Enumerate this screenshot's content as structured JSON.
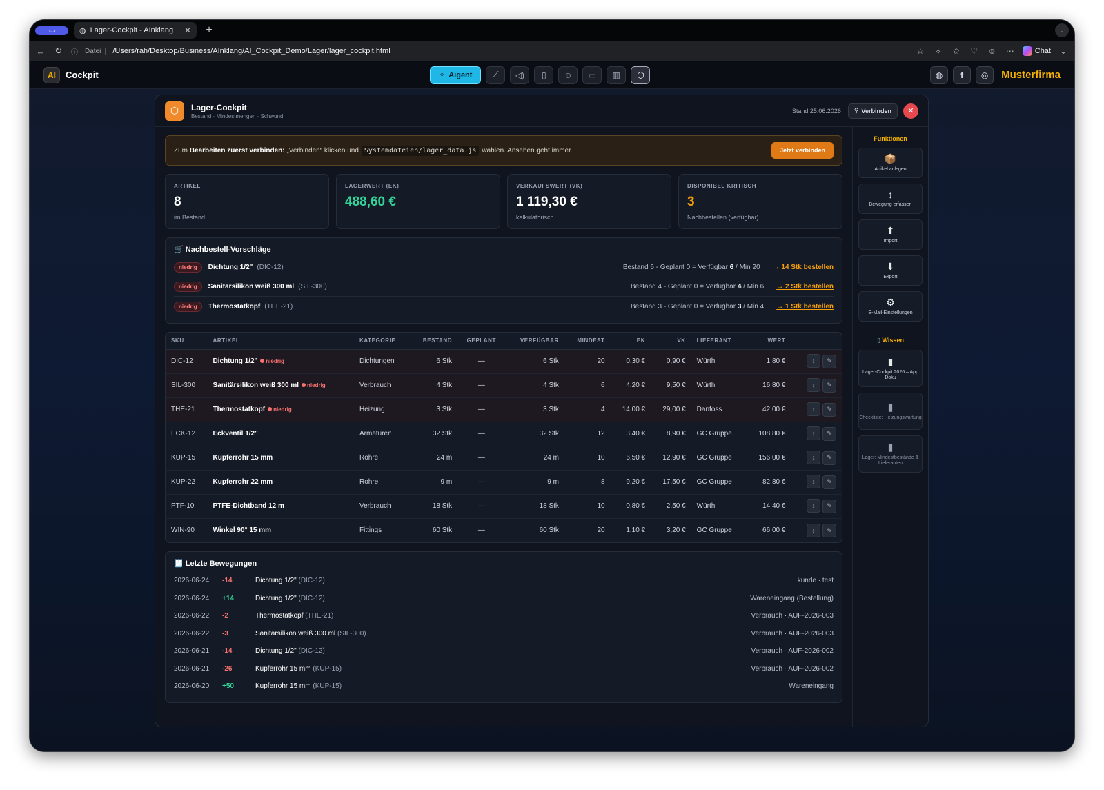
{
  "browser": {
    "tab_title": "Lager-Cockpit - AInklang",
    "url_prefix": "Datei",
    "url": "/Users/rah/Desktop/Business/AInklang/AI_Cockpit_Demo/Lager/lager_cockpit.html",
    "chat_label": "Chat"
  },
  "app": {
    "logo": "AI",
    "name": "Cockpit",
    "agent_label": "Aigent",
    "company": "Musterfirma"
  },
  "modal": {
    "title": "Lager-Cockpit",
    "subtitle": "Bestand · Mindestmengen · Schwund",
    "stand": "Stand 25.06.2026",
    "connect_label": "Verbinden"
  },
  "banner": {
    "prefix": "Zum",
    "bold": "Bearbeiten zuerst verbinden:",
    "middle": "„Verbinden“ klicken und",
    "code": "Systemdateien/lager_data.js",
    "suffix": "wählen. Ansehen geht immer.",
    "button": "Jetzt verbinden"
  },
  "kpis": [
    {
      "label": "ARTIKEL",
      "value": "8",
      "sub": "im Bestand"
    },
    {
      "label": "LAGERWERT (EK)",
      "value": "488,60 €",
      "sub": ""
    },
    {
      "label": "VERKAUFSWERT (VK)",
      "value": "1 119,30 €",
      "sub": "kalkulatorisch"
    },
    {
      "label": "DISPONIBEL KRITISCH",
      "value": "3",
      "sub": "Nachbestellen (verfügbar)"
    }
  ],
  "reorder": {
    "title": "Nachbestell-Vorschläge",
    "items": [
      {
        "badge": "niedrig",
        "name": "Dichtung 1/2\"",
        "sku": "(DIC-12)",
        "calc_pre": "Bestand 6 - Geplant 0 = Verfügbar",
        "avail": "6",
        "calc_post": "/ Min 20",
        "order": "→ 14 Stk bestellen"
      },
      {
        "badge": "niedrig",
        "name": "Sanitärsilikon weiß 300 ml",
        "sku": "(SIL-300)",
        "calc_pre": "Bestand 4 - Geplant 0 = Verfügbar",
        "avail": "4",
        "calc_post": "/ Min 6",
        "order": "→ 2 Stk bestellen"
      },
      {
        "badge": "niedrig",
        "name": "Thermostatkopf",
        "sku": "(THE-21)",
        "calc_pre": "Bestand 3 - Geplant 0 = Verfügbar",
        "avail": "3",
        "calc_post": "/ Min 4",
        "order": "→ 1 Stk bestellen"
      }
    ]
  },
  "table": {
    "headers": [
      "SKU",
      "ARTIKEL",
      "KATEGORIE",
      "BESTAND",
      "GEPLANT",
      "VERFÜGBAR",
      "MINDEST",
      "EK",
      "VK",
      "LIEFERANT",
      "WERT"
    ],
    "low_label": "niedrig",
    "rows": [
      {
        "sku": "DIC-12",
        "name": "Dichtung 1/2\"",
        "low": true,
        "cat": "Dichtungen",
        "stock": "6 Stk",
        "planned": "—",
        "avail": "6 Stk",
        "min": "20",
        "ek": "0,30 €",
        "vk": "0,90 €",
        "supplier": "Würth",
        "value": "1,80 €"
      },
      {
        "sku": "SIL-300",
        "name": "Sanitärsilikon weiß 300 ml",
        "low": true,
        "cat": "Verbrauch",
        "stock": "4 Stk",
        "planned": "—",
        "avail": "4 Stk",
        "min": "6",
        "ek": "4,20 €",
        "vk": "9,50 €",
        "supplier": "Würth",
        "value": "16,80 €"
      },
      {
        "sku": "THE-21",
        "name": "Thermostatkopf",
        "low": true,
        "cat": "Heizung",
        "stock": "3 Stk",
        "planned": "—",
        "avail": "3 Stk",
        "min": "4",
        "ek": "14,00 €",
        "vk": "29,00 €",
        "supplier": "Danfoss",
        "value": "42,00 €"
      },
      {
        "sku": "ECK-12",
        "name": "Eckventil 1/2\"",
        "low": false,
        "cat": "Armaturen",
        "stock": "32 Stk",
        "planned": "—",
        "avail": "32 Stk",
        "min": "12",
        "ek": "3,40 €",
        "vk": "8,90 €",
        "supplier": "GC Gruppe",
        "value": "108,80 €"
      },
      {
        "sku": "KUP-15",
        "name": "Kupferrohr 15 mm",
        "low": false,
        "cat": "Rohre",
        "stock": "24 m",
        "planned": "—",
        "avail": "24 m",
        "min": "10",
        "ek": "6,50 €",
        "vk": "12,90 €",
        "supplier": "GC Gruppe",
        "value": "156,00 €"
      },
      {
        "sku": "KUP-22",
        "name": "Kupferrohr 22 mm",
        "low": false,
        "cat": "Rohre",
        "stock": "9 m",
        "planned": "—",
        "avail": "9 m",
        "min": "8",
        "ek": "9,20 €",
        "vk": "17,50 €",
        "supplier": "GC Gruppe",
        "value": "82,80 €"
      },
      {
        "sku": "PTF-10",
        "name": "PTFE-Dichtband 12 m",
        "low": false,
        "cat": "Verbrauch",
        "stock": "18 Stk",
        "planned": "—",
        "avail": "18 Stk",
        "min": "10",
        "ek": "0,80 €",
        "vk": "2,50 €",
        "supplier": "Würth",
        "value": "14,40 €"
      },
      {
        "sku": "WIN-90",
        "name": "Winkel 90° 15 mm",
        "low": false,
        "cat": "Fittings",
        "stock": "60 Stk",
        "planned": "—",
        "avail": "60 Stk",
        "min": "20",
        "ek": "1,10 €",
        "vk": "3,20 €",
        "supplier": "GC Gruppe",
        "value": "66,00 €"
      }
    ]
  },
  "moves": {
    "title": "Letzte Bewegungen",
    "rows": [
      {
        "date": "2026-06-24",
        "qty": "-14",
        "name": "Dichtung 1/2\"",
        "sku": "(DIC-12)",
        "info": "kunde · test"
      },
      {
        "date": "2026-06-24",
        "qty": "+14",
        "name": "Dichtung 1/2\"",
        "sku": "(DIC-12)",
        "info": "Wareneingang (Bestellung)"
      },
      {
        "date": "2026-06-22",
        "qty": "-2",
        "name": "Thermostatkopf",
        "sku": "(THE-21)",
        "info": "Verbrauch · AUF-2026-003"
      },
      {
        "date": "2026-06-22",
        "qty": "-3",
        "name": "Sanitärsilikon weiß 300 ml",
        "sku": "(SIL-300)",
        "info": "Verbrauch · AUF-2026-003"
      },
      {
        "date": "2026-06-21",
        "qty": "-14",
        "name": "Dichtung 1/2\"",
        "sku": "(DIC-12)",
        "info": "Verbrauch · AUF-2026-002"
      },
      {
        "date": "2026-06-21",
        "qty": "-26",
        "name": "Kupferrohr 15 mm",
        "sku": "(KUP-15)",
        "info": "Verbrauch · AUF-2026-002"
      },
      {
        "date": "2026-06-20",
        "qty": "+50",
        "name": "Kupferrohr 15 mm",
        "sku": "(KUP-15)",
        "info": "Wareneingang"
      }
    ]
  },
  "sidebar": {
    "functions_title": "Funktionen",
    "functions": [
      {
        "icon": "package-icon",
        "label": "Artikel anlegen"
      },
      {
        "icon": "updown-arrow-icon",
        "label": "Bewegung erfassen"
      },
      {
        "icon": "up-arrow-icon",
        "label": "Import"
      },
      {
        "icon": "down-arrow-icon",
        "label": "Export"
      },
      {
        "icon": "gear-icon",
        "label": "E-Mail-Einstellungen"
      }
    ],
    "knowledge_title": "Wissen",
    "docs": [
      {
        "label": "Lager-Cockpit 2026 – App Doku"
      },
      {
        "label": "Checkliste: Heizungswartung"
      },
      {
        "label": "Lager: Mindestbestände & Lieferanten"
      }
    ]
  },
  "colors": {
    "accent": "#f5b000",
    "agent": "#1fb8e6",
    "warning": "#e07a16",
    "danger": "#f87171",
    "positive": "#34d399"
  }
}
